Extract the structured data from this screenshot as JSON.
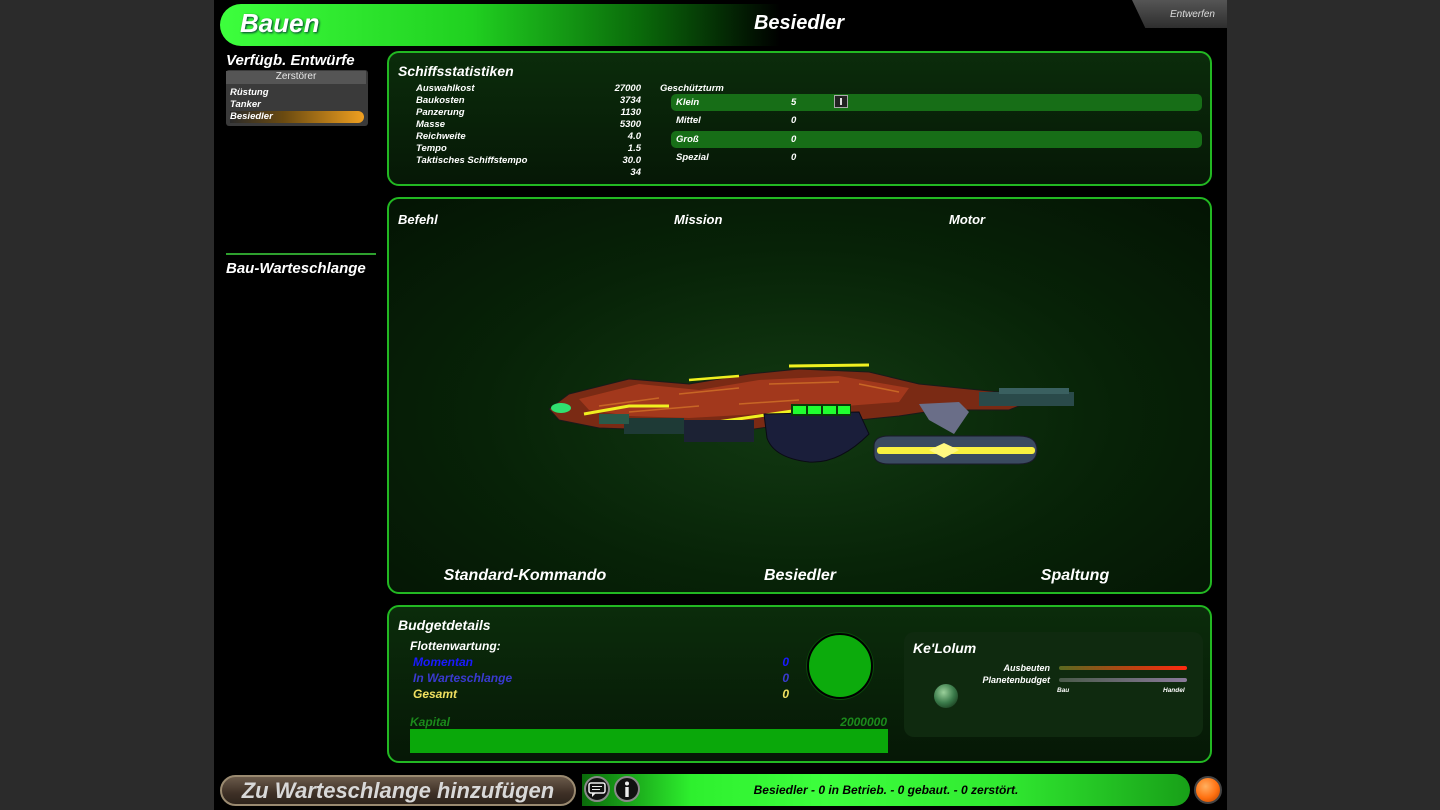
{
  "header": {
    "title": "Bauen",
    "ship_name": "Besiedler",
    "design_tab": "Entwerfen"
  },
  "designs": {
    "heading": "Verfügb. Entwürfe",
    "category": "Zerstörer",
    "items": [
      {
        "label": "Rüstung",
        "selected": false
      },
      {
        "label": "Tanker",
        "selected": false
      },
      {
        "label": "Besiedler",
        "selected": true
      }
    ]
  },
  "queue": {
    "heading": "Bau-Warteschlange"
  },
  "stats": {
    "title": "Schiffsstatistiken",
    "rows": [
      {
        "label": "Auswahlkost",
        "value": "27000"
      },
      {
        "label": "Baukosten",
        "value": "3734"
      },
      {
        "label": "Panzerung",
        "value": "1130"
      },
      {
        "label": "Masse",
        "value": "5300"
      },
      {
        "label": "Reichweite",
        "value": "4.0"
      },
      {
        "label": "Tempo",
        "value": "1.5"
      },
      {
        "label": "Taktisches Schiffstempo",
        "value": "30.0"
      },
      {
        "label": "",
        "value": "34"
      }
    ],
    "turret_heading": "Geschützturm",
    "turrets": [
      {
        "label": "Klein",
        "value": "5"
      },
      {
        "label": "Mittel",
        "value": "0"
      },
      {
        "label": "Groß",
        "value": "0"
      },
      {
        "label": "Spezial",
        "value": "0"
      }
    ]
  },
  "slots": {
    "command_label": "Befehl",
    "mission_label": "Mission",
    "engine_label": "Motor",
    "command_value": "Standard-Kommando",
    "mission_value": "Besiedler",
    "engine_value": "Spaltung"
  },
  "budget": {
    "title": "Budgetdetails",
    "fleet_label": "Flottenwartung:",
    "rows": [
      {
        "label": "Momentan",
        "value": "0",
        "color": "#1a1aff"
      },
      {
        "label": "In Warteschlange",
        "value": "0",
        "color": "#3a3ad0"
      },
      {
        "label": "Gesamt",
        "value": "0",
        "color": "#f0e060"
      }
    ],
    "capital_label": "Kapital",
    "capital_value": "2000000"
  },
  "planet": {
    "name": "Ke'Lolum",
    "exploit_label": "Ausbeuten",
    "budget_label": "Planetenbudget",
    "left_label": "Bau",
    "right_label": "Handel"
  },
  "footer": {
    "add_button": "Zu Warteschlange hinzufügen",
    "status": "Besiedler - 0 in Betrieb. - 0 gebaut. - 0 zerstört."
  },
  "colors": {
    "accent": "#22b822",
    "bright_green": "#3dff3d",
    "highlight": "#176e17"
  }
}
